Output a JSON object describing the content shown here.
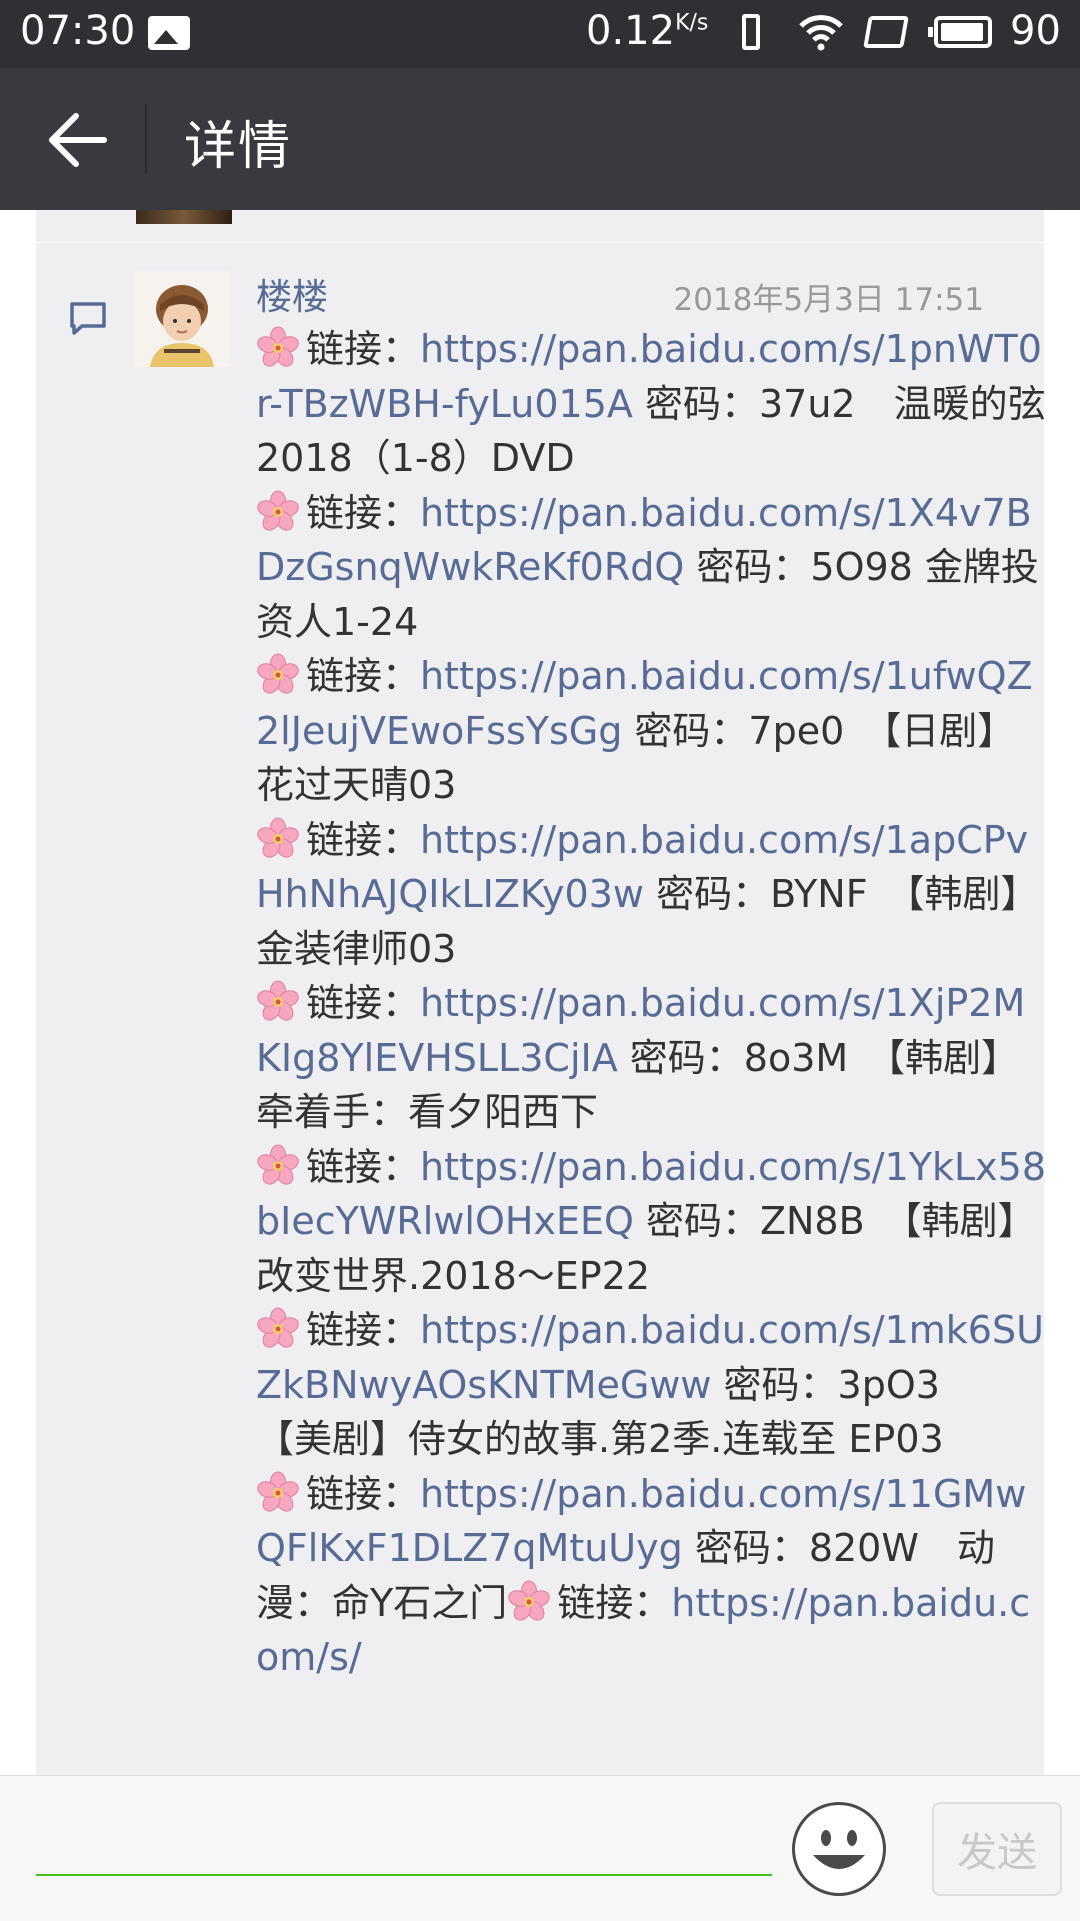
{
  "status_bar": {
    "time": "07:30",
    "net_speed": "0.12",
    "net_unit": "K/s",
    "battery": "90"
  },
  "header": {
    "title": "详情",
    "back_icon": "arrow-left-icon"
  },
  "comment": {
    "username": "楼楼",
    "timestamp": "2018年5月3日 17:51",
    "icon": "comment-icon",
    "entries": [
      {
        "prefix": "链接：",
        "url": "https://pan.baidu.com/s/1pnWT0r-TBzWBH-fyLu015A",
        "suffix": " 密码：37u2　温暖的弦 2018（1-8）DVD"
      },
      {
        "prefix": "链接：",
        "url": "https://pan.baidu.com/s/1X4v7BDzGsnqWwkReKf0RdQ",
        "suffix": " 密码：5O98  金牌投资人1-24"
      },
      {
        "prefix": "链接：",
        "url": "https://pan.baidu.com/s/1ufwQZ2lJeujVEwoFssYsGg",
        "suffix": " 密码：7pe0　【日剧】花过天晴03"
      },
      {
        "prefix": "链接：",
        "url": "https://pan.baidu.com/s/1apCPvHhNhAJQIkLIZKy03w",
        "suffix": " 密码：BYNF　【韩剧】金装律师03"
      },
      {
        "prefix": "链接：",
        "url": "https://pan.baidu.com/s/1XjP2MKIg8YlEVHSLL3CjIA",
        "suffix": " 密码：8o3M　【韩剧】牵着手：看夕阳西下"
      },
      {
        "prefix": "链接：",
        "url": "https://pan.baidu.com/s/1YkLx58bIecYWRlwlOHxEEQ",
        "suffix": " 密码：ZN8B　【韩剧】改变世界.2018～EP22"
      },
      {
        "prefix": "链接：",
        "url": "https://pan.baidu.com/s/1mk6SUZkBNwyAOsKNTMeGww",
        "suffix": " 密码：3pO3　 【美剧】侍女的故事.第2季.连载至 EP03"
      },
      {
        "prefix": "链接：",
        "url": "https://pan.baidu.com/s/11GMwQFlKxF1DLZ7qMtuUyg",
        "suffix": " 密码：820W　动漫：命Y石之门"
      },
      {
        "prefix": "链接：",
        "url": "https://pan.baidu.com/s/",
        "suffix": ""
      }
    ]
  },
  "reply_bar": {
    "input_value": "",
    "emoji_icon": "smiley-face-icon",
    "send_label": "发送"
  }
}
